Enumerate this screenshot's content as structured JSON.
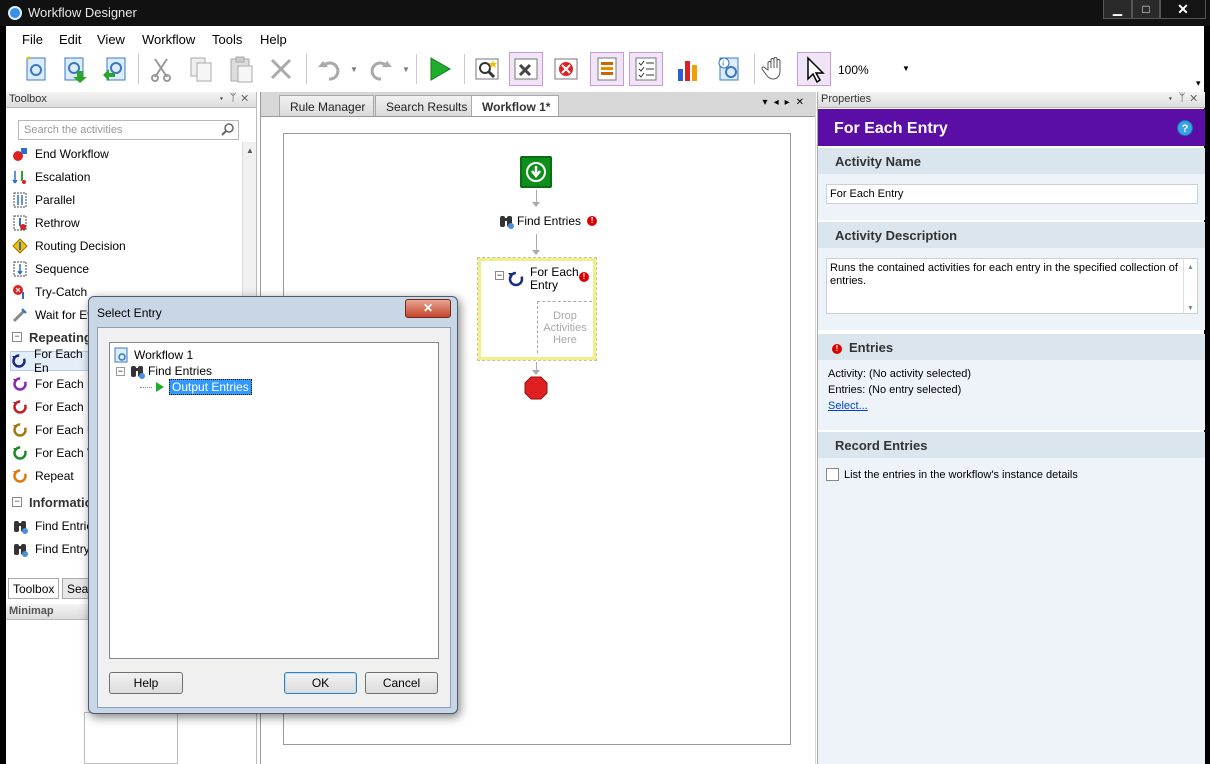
{
  "window": {
    "title": "Workflow Designer",
    "min": "▁",
    "max": "□",
    "close": "✕"
  },
  "menu": [
    "File",
    "Edit",
    "View",
    "Workflow",
    "Tools",
    "Help"
  ],
  "toolbar": {
    "zoom": "100%"
  },
  "toolbox": {
    "title": "Toolbox",
    "search_placeholder": "Search the activities",
    "items": [
      {
        "label": "End Workflow",
        "icon": "end-workflow-icon"
      },
      {
        "label": "Escalation",
        "icon": "escalation-icon"
      },
      {
        "label": "Parallel",
        "icon": "parallel-icon"
      },
      {
        "label": "Rethrow",
        "icon": "rethrow-icon"
      },
      {
        "label": "Routing Decision",
        "icon": "routing-decision-icon"
      },
      {
        "label": "Sequence",
        "icon": "sequence-icon"
      },
      {
        "label": "Try-Catch",
        "icon": "try-catch-icon"
      },
      {
        "label": "Wait for Ev",
        "icon": "wait-icon"
      }
    ],
    "group_repeating": "Repeating",
    "repeating_items": [
      {
        "label": "For Each En",
        "icon": "for-each-icon"
      },
      {
        "label": "For Each Fi",
        "icon": "for-each-icon"
      },
      {
        "label": "For Each R",
        "icon": "for-each-icon"
      },
      {
        "label": "For Each U",
        "icon": "for-each-icon"
      },
      {
        "label": "For Each Va",
        "icon": "for-each-icon"
      },
      {
        "label": "Repeat",
        "icon": "repeat-icon"
      }
    ],
    "group_information": "Informatio",
    "information_items": [
      {
        "label": "Find Entries",
        "icon": "binoculars-icon"
      },
      {
        "label": "Find Entry",
        "icon": "binoculars-icon"
      }
    ],
    "tabs": [
      "Toolbox",
      "Sear"
    ],
    "minimap_title": "Minimap"
  },
  "document": {
    "tabs": [
      "Rule Manager",
      "Search Results",
      "Workflow 1*"
    ],
    "active_tab": "Workflow 1*",
    "nodes": {
      "find_entries": "Find Entries",
      "for_each_line1": "For Each",
      "for_each_line2": "Entry",
      "drop_line1": "Drop",
      "drop_line2": "Activities",
      "drop_line3": "Here"
    }
  },
  "properties": {
    "panel_title": "Properties",
    "title": "For Each Entry",
    "help": "?",
    "activity_name_label": "Activity Name",
    "activity_name_value": "For Each Entry",
    "activity_description_label": "Activity Description",
    "activity_description_value": "Runs the contained activities for each entry in the specified collection of entries.",
    "entries_label": "Entries",
    "activity_line": "Activity:  (No activity selected)",
    "entries_line": "Entries:   (No entry selected)",
    "select_link": "Select...",
    "record_entries_label": "Record Entries",
    "record_checkbox_label": "List the entries in the workflow's instance details"
  },
  "dialog": {
    "title": "Select Entry",
    "close": "✕",
    "tree": {
      "root": "Workflow 1",
      "child": "Find Entries",
      "leaf": "Output Entries"
    },
    "help_button": "Help",
    "ok_button": "OK",
    "cancel_button": "Cancel"
  },
  "colors": {
    "properties_header": "#5b0ea6",
    "section_header": "#dbe5ee",
    "start_node": "#0f8f1b",
    "selection": "#3399ff"
  }
}
